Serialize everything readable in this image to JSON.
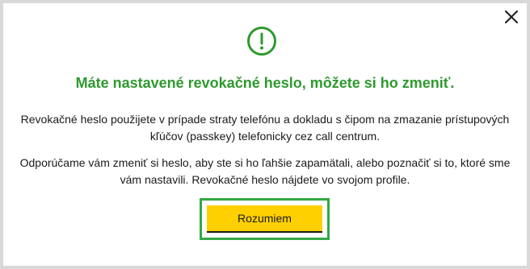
{
  "dialog": {
    "title": "Máte nastavené revokačné heslo, môžete si ho zmeniť.",
    "paragraph_1": "Revokačné heslo použijete v prípade straty telefónu a dokladu s čipom na zmazanie prístupových kľúčov (passkey) telefonicky cez call centrum.",
    "paragraph_2": "Odporúčame vám zmeniť si heslo, aby ste si ho ľahšie zapamätali, alebo poznačiť si to, ktoré sme vám nastavili. Revokačné heslo nájdete vo svojom profile.",
    "confirm_button_label": "Rozumiem",
    "icons": {
      "status": "exclamation-circle-icon",
      "close": "close-icon"
    }
  },
  "colors": {
    "accent_green": "#2e9a2e",
    "focus_outline": "#33a845",
    "button_yellow": "#ffd000",
    "text": "#1a1a1a",
    "backdrop": "#d9d9d9",
    "surface": "#ffffff"
  }
}
